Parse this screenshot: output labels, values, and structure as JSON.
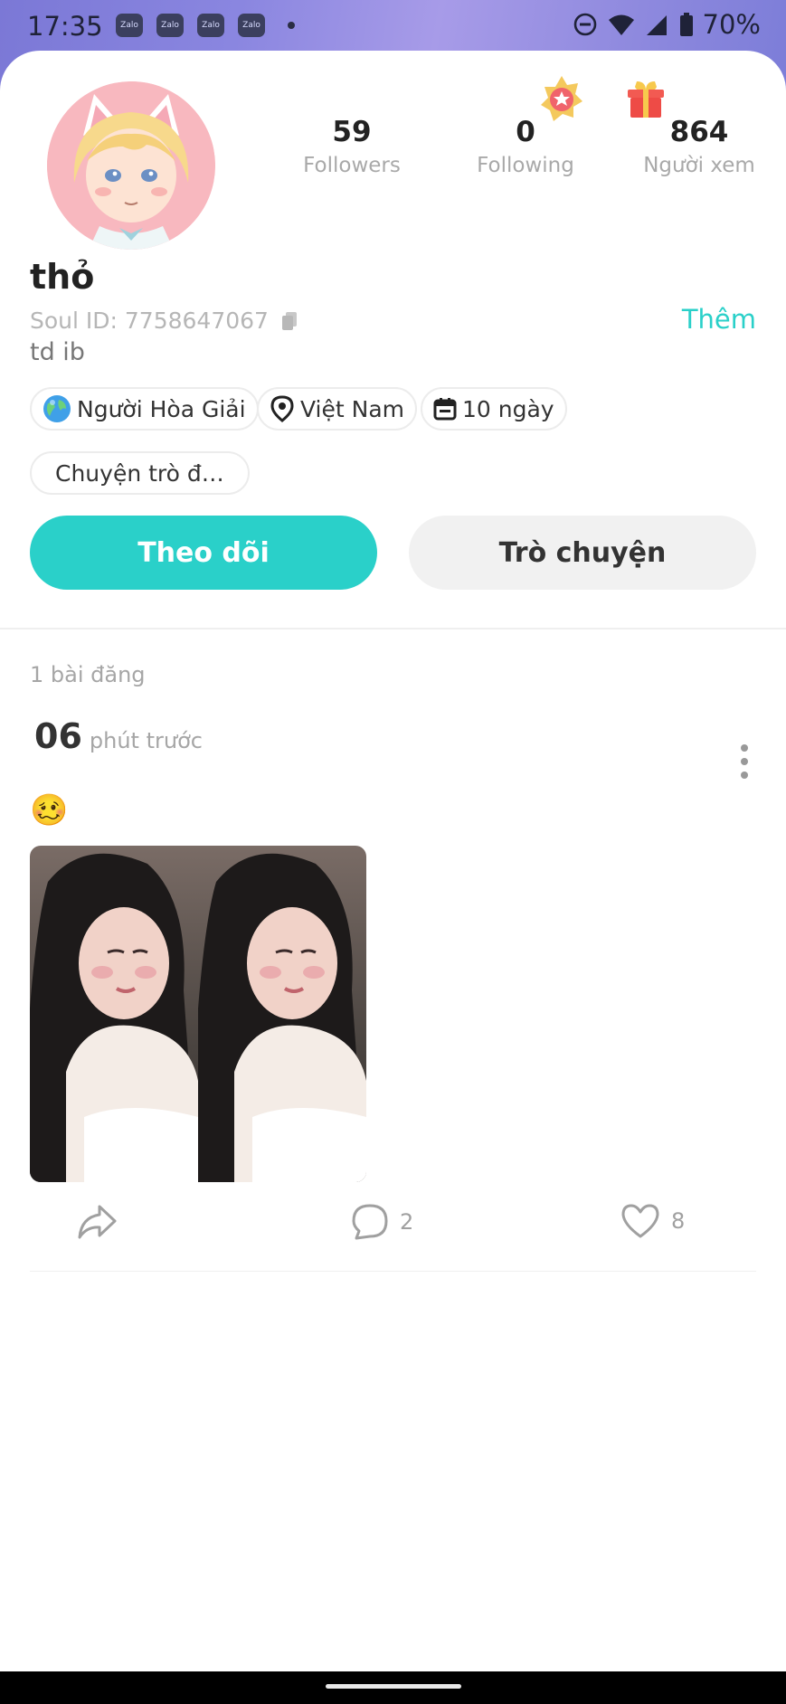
{
  "status_bar": {
    "time": "17:35",
    "notification_apps": [
      "Zalo",
      "Zalo",
      "Zalo",
      "Zalo"
    ],
    "battery": "70%",
    "icons": [
      "do-not-disturb-icon",
      "wifi-icon",
      "cell-signal-icon",
      "battery-icon"
    ]
  },
  "profile": {
    "stats": [
      {
        "value": "59",
        "label": "Followers"
      },
      {
        "value": "0",
        "label": "Following"
      },
      {
        "value": "864",
        "label": "Người xem"
      }
    ],
    "username": "thỏ",
    "soul_id": "Soul ID: 7758647067",
    "bio": "td ib",
    "more_label": "Thêm",
    "tags": [
      {
        "icon": "globe-icon",
        "label": "Người Hòa Giải"
      },
      {
        "icon": "location-pin-icon",
        "label": "Việt Nam"
      },
      {
        "icon": "calendar-icon",
        "label": "10 ngày"
      },
      {
        "icon": "",
        "label": "Chuyện trò đ…"
      }
    ],
    "follow_label": "Theo dõi",
    "chat_label": "Trò chuyện"
  },
  "posts": {
    "count_label": "1 bài đăng",
    "items": [
      {
        "time_value": "06",
        "time_unit": "phút trước",
        "emoji": "🥴",
        "comments": "2",
        "likes": "8"
      }
    ]
  },
  "colors": {
    "accent": "#2ad0c9",
    "header_purple": "#8a86e0",
    "chat_button_bg": "#f1f1f1"
  }
}
